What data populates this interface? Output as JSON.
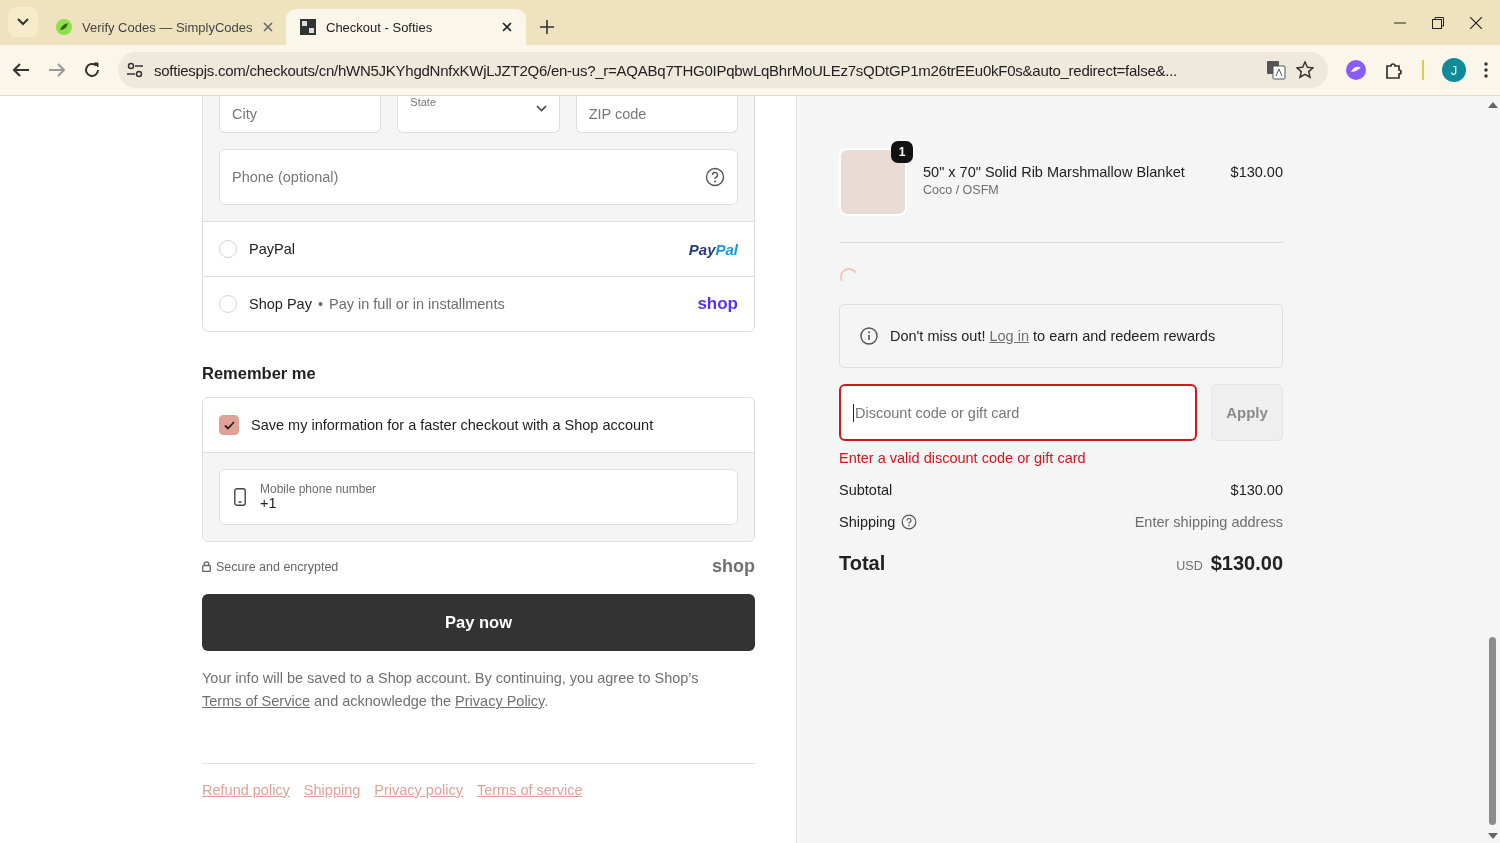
{
  "browser": {
    "tabs": [
      {
        "title": "Verify Codes — SimplyCodes",
        "selected": false
      },
      {
        "title": "Checkout - Softies",
        "selected": true
      }
    ],
    "url": "softiespjs.com/checkouts/cn/hWN5JKYhgdNnfxKWjLJZT2Q6/en-us?_r=AQABq7THG0IPqbwLqBhrMoULEz7sQDtGP1m26trEEu0kF0s&auto_redirect=false&...",
    "profile_initial": "J"
  },
  "address_form": {
    "city_placeholder": "City",
    "state_label": "State",
    "zip_placeholder": "ZIP code",
    "phone_placeholder": "Phone (optional)"
  },
  "payment_methods": [
    {
      "kind": "paypal",
      "label": "PayPal",
      "selected": false,
      "logo": [
        "Pay",
        "Pal"
      ]
    },
    {
      "kind": "shoppay",
      "label": "Shop Pay",
      "separator": "•",
      "note": "Pay in full or in installments",
      "selected": false,
      "logo": [
        "shop"
      ]
    }
  ],
  "remember_me": {
    "heading": "Remember me",
    "checkbox_label": "Save my information for a faster checkout with a Shop account",
    "checked": true,
    "mobile_label": "Mobile phone number",
    "mobile_value": "+1"
  },
  "secure_note": "Secure and encrypted",
  "shop_logo": "shop",
  "pay_button": "Pay now",
  "legal": {
    "before": "Your info will be saved to a Shop account. By continuing, you agree to Shop’s",
    "terms_link": "Terms of Service",
    "middle": "and acknowledge the",
    "privacy_link": "Privacy Policy",
    "end": "."
  },
  "footer_links": [
    "Refund policy",
    "Shipping",
    "Privacy policy",
    "Terms of service"
  ],
  "summary": {
    "items": [
      {
        "name": "50\" x 70\" Solid Rib Marshmallow Blanket",
        "variant": "Coco / OSFM",
        "price": "$130.00",
        "quantity": "1"
      }
    ],
    "rewards": {
      "before": "Don't miss out!",
      "link": "Log in",
      "after": "to earn and redeem rewards"
    },
    "discount": {
      "placeholder": "Discount code or gift card",
      "invalid": true,
      "error": "Enter a valid discount code or gift card",
      "apply": "Apply"
    },
    "subtotal": {
      "label": "Subtotal",
      "value": "$130.00"
    },
    "shipping": {
      "label": "Shipping",
      "value": "Enter shipping address"
    },
    "total": {
      "label": "Total",
      "currency": "USD",
      "value": "$130.00"
    }
  }
}
